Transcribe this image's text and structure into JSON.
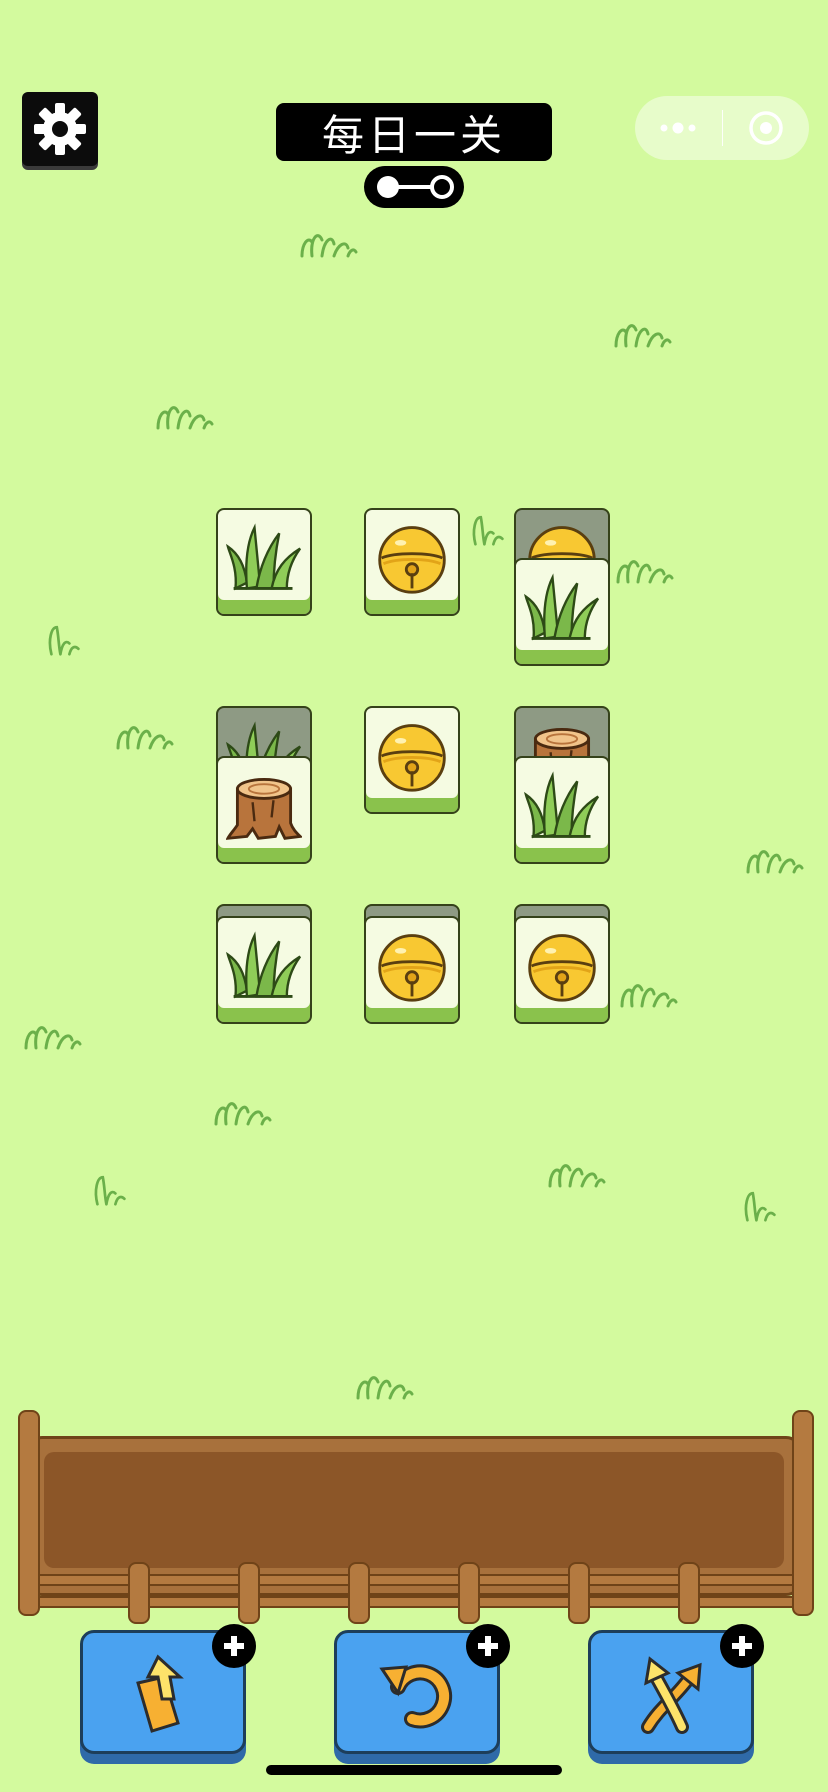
{
  "header": {
    "title": "每日一关"
  },
  "icons": {
    "settings": "gear-icon",
    "more": "more-dots-icon",
    "close_miniapp": "target-circle-icon"
  },
  "board": {
    "tiles": [
      {
        "type": "grass",
        "layer": "top"
      },
      {
        "type": "bell",
        "layer": "top"
      },
      {
        "type": "bell",
        "layer": "under"
      },
      {
        "type": "grass",
        "layer": "top"
      },
      {
        "type": "grass",
        "layer": "under"
      },
      {
        "type": "stump",
        "layer": "top"
      },
      {
        "type": "bell",
        "layer": "top"
      },
      {
        "type": "stump",
        "layer": "under"
      },
      {
        "type": "grass",
        "layer": "top"
      },
      {
        "type": "grass",
        "layer": "top"
      },
      {
        "type": "bell",
        "layer": "top"
      },
      {
        "type": "bell",
        "layer": "top"
      }
    ]
  },
  "tools": [
    {
      "name": "move-out",
      "icon": "move-out-icon"
    },
    {
      "name": "undo",
      "icon": "undo-icon"
    },
    {
      "name": "shuffle",
      "icon": "shuffle-icon"
    }
  ],
  "colors": {
    "background": "#d3fa9e",
    "tile_face": "#f5fbe2",
    "tile_base": "#8ac24c",
    "bell": "#f8c832",
    "stump": "#b8743c",
    "tool_button": "#4aa2f0"
  }
}
